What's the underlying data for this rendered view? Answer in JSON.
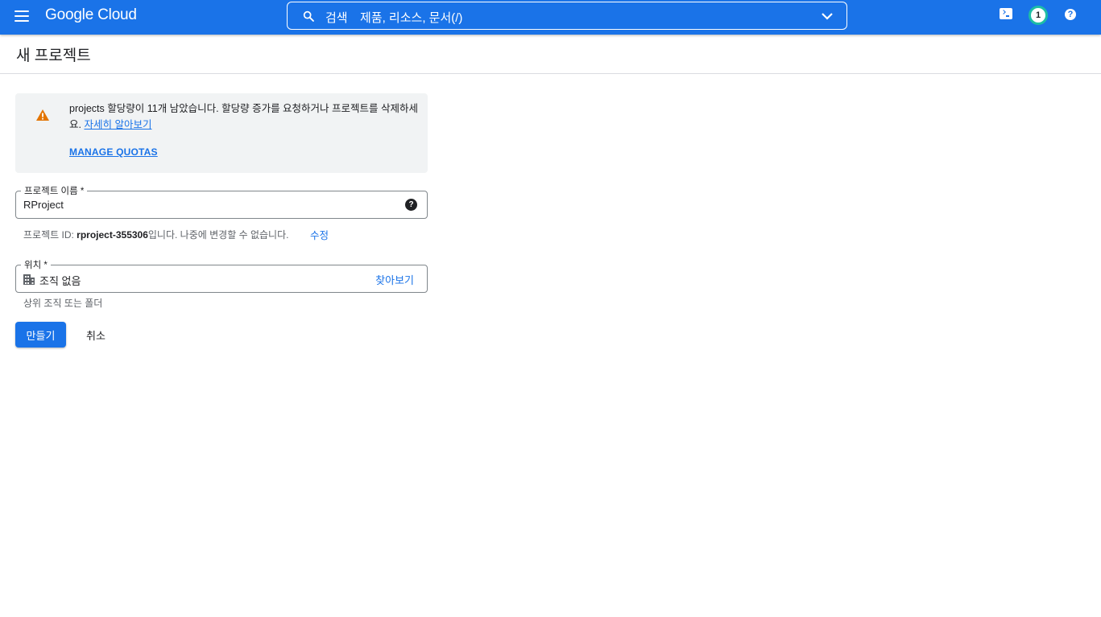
{
  "header": {
    "brand": "Google Cloud",
    "search": {
      "label": "검색",
      "placeholder": "제품, 리소스, 문서(/)"
    },
    "notification_count": "1",
    "help_glyph": "?"
  },
  "page": {
    "title": "새 프로젝트"
  },
  "alert": {
    "message": "projects 할당량이 11개 남았습니다. 할당량 증가를 요청하거나 프로젝트를 삭제하세요.",
    "learn_more": "자세히 알아보기",
    "manage_quotas": "MANAGE QUOTAS"
  },
  "project_name_field": {
    "label": "프로젝트 이름 *",
    "value": "RProject",
    "help_glyph": "?"
  },
  "project_id_hint": {
    "prefix": "프로젝트 ID: ",
    "id": "rproject-355306",
    "suffix": "입니다. 나중에 변경할 수 없습니다.",
    "edit": "수정"
  },
  "location_field": {
    "label": "위치 *",
    "value": "조직 없음",
    "browse": "찾아보기",
    "hint": "상위 조직 또는 폴더"
  },
  "actions": {
    "create": "만들기",
    "cancel": "취소"
  },
  "colors": {
    "brand_blue": "#1a73e8",
    "warning": "#e37400",
    "alert_bg": "#f1f3f4",
    "notif_ring": "#1ebea5"
  }
}
